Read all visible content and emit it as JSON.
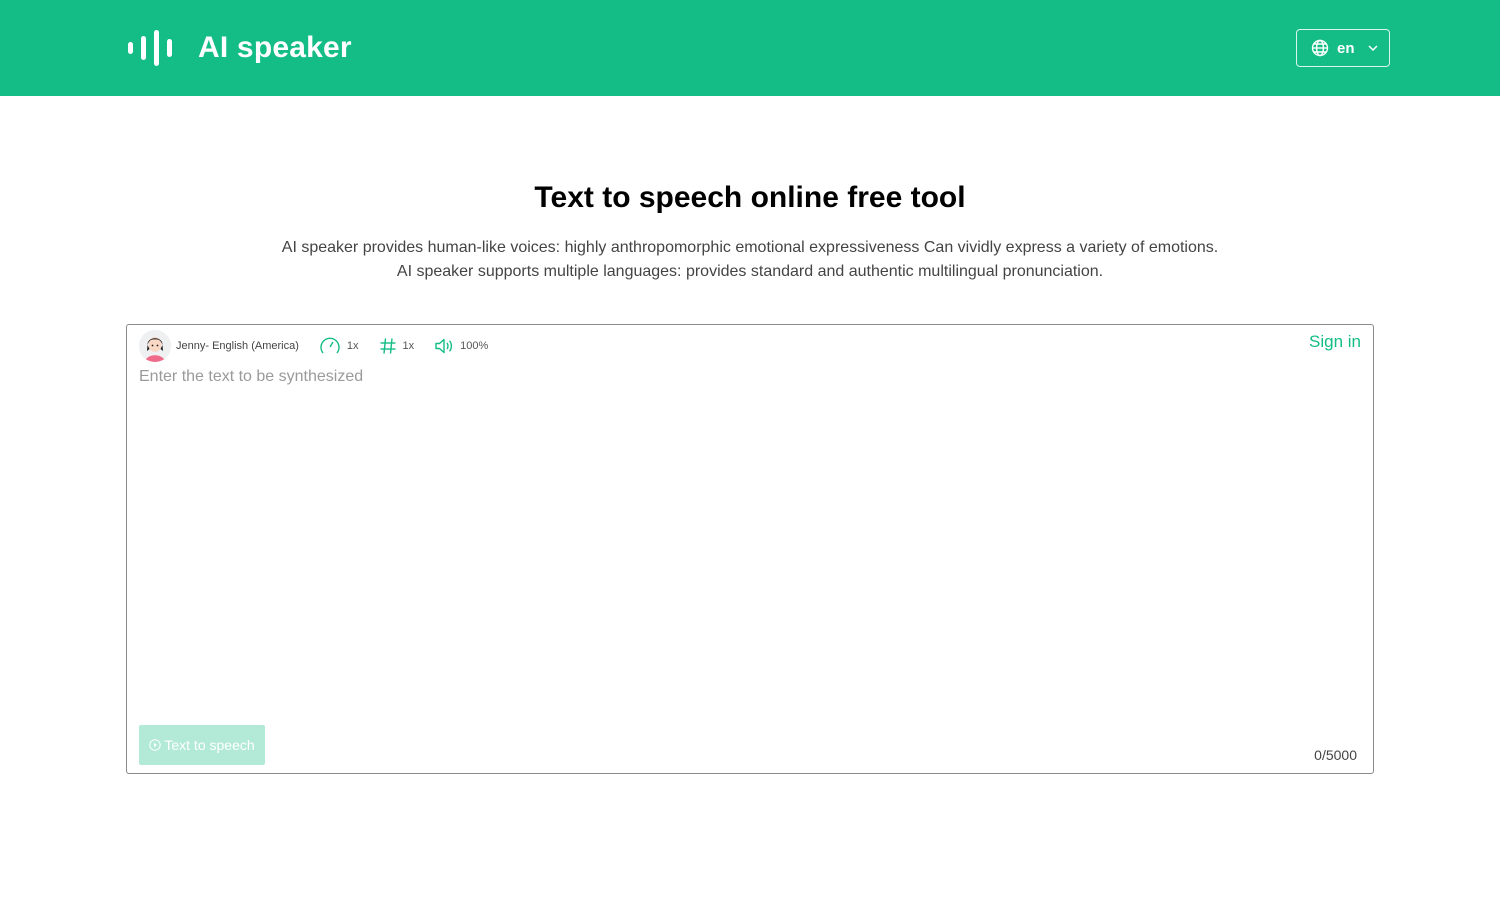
{
  "header": {
    "brand_title": "AI speaker",
    "brand_icon": "audio-wave-icon",
    "language": "en",
    "language_icon": "globe-icon",
    "dropdown_icon": "chevron-down-icon"
  },
  "hero": {
    "title": "Text to speech online free tool",
    "line1": "AI speaker provides human-like voices: highly anthropomorphic emotional expressiveness Can vividly express a variety of emotions.",
    "line2": "AI speaker supports multiple languages: provides standard and authentic multilingual pronunciation."
  },
  "editor": {
    "voice": "Jenny- English (America)",
    "speed": "1x",
    "pitch": "1x",
    "volume": "100%",
    "sign_in": "Sign in",
    "placeholder": "Enter the text to be synthesized",
    "value": "",
    "tts_button": "Text to speech",
    "counter": "0/5000"
  },
  "colors": {
    "brand": "#13bd85",
    "button_disabled": "#b2ead7"
  }
}
